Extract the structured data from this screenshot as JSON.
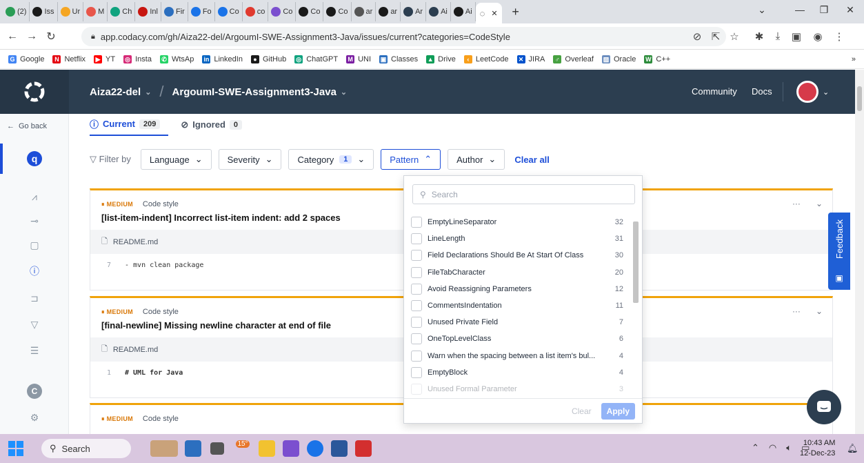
{
  "browser": {
    "tabs": [
      {
        "label": "(2)",
        "color": "#2a9d56"
      },
      {
        "label": "Iss",
        "color": "#1a1a1a"
      },
      {
        "label": "Ur",
        "color": "#f5a623"
      },
      {
        "label": "M",
        "color": "#e8564a"
      },
      {
        "label": "Ch",
        "color": "#10a37f"
      },
      {
        "label": "Inl",
        "color": "#c71610"
      },
      {
        "label": "Fir",
        "color": "#2c6fbf"
      },
      {
        "label": "Fo",
        "color": "#1a73e8"
      },
      {
        "label": "Co",
        "color": "#1a73e8"
      },
      {
        "label": "co",
        "color": "#e03a2f"
      },
      {
        "label": "Co",
        "color": "#7b4fcf"
      },
      {
        "label": "Co",
        "color": "#1a1a1a"
      },
      {
        "label": "Co",
        "color": "#1a1a1a"
      },
      {
        "label": "ar",
        "color": "#555555"
      },
      {
        "label": "ar",
        "color": "#1a1a1a"
      },
      {
        "label": "Ar",
        "color": "#2c3e50"
      },
      {
        "label": "Ai",
        "color": "#2c3e50"
      },
      {
        "label": "Ai",
        "color": "#1a1a1a"
      }
    ],
    "url": "app.codacy.com/gh/Aiza22-del/ArgoumI-SWE-Assignment3-Java/issues/current?categories=CodeStyle",
    "bookmarks": [
      {
        "label": "Google",
        "color": "#4285f4",
        "glyph": "G"
      },
      {
        "label": "Netflix",
        "color": "#e50914",
        "glyph": "N"
      },
      {
        "label": "YT",
        "color": "#ff0000",
        "glyph": "▶"
      },
      {
        "label": "Insta",
        "color": "#d62976",
        "glyph": "◎"
      },
      {
        "label": "WtsAp",
        "color": "#25d366",
        "glyph": "✆"
      },
      {
        "label": "LinkedIn",
        "color": "#0a66c2",
        "glyph": "in"
      },
      {
        "label": "GitHub",
        "color": "#1a1a1a",
        "glyph": "●"
      },
      {
        "label": "ChatGPT",
        "color": "#10a37f",
        "glyph": "◎"
      },
      {
        "label": "UNI",
        "color": "#7b1fa2",
        "glyph": "M"
      },
      {
        "label": "Classes",
        "color": "#2c6fbf",
        "glyph": "▣"
      },
      {
        "label": "Drive",
        "color": "#0f9d58",
        "glyph": "▲"
      },
      {
        "label": "LeetCode",
        "color": "#f89f1b",
        "glyph": "‹"
      },
      {
        "label": "JIRA",
        "color": "#0052cc",
        "glyph": "✕"
      },
      {
        "label": "Overleaf",
        "color": "#47a141",
        "glyph": "♂"
      },
      {
        "label": "Oracle",
        "color": "#6c8ebf",
        "glyph": "▨"
      },
      {
        "label": "C++",
        "color": "#2d8c3c",
        "glyph": "W"
      }
    ],
    "more_bookmarks": "»"
  },
  "header": {
    "org": "Aiza22-del",
    "repo": "ArgoumI-SWE-Assignment3-Java",
    "community": "Community",
    "docs": "Docs"
  },
  "sidebar": {
    "go_back": "Go back"
  },
  "issues_tabs": [
    {
      "label": "Current",
      "count": "209"
    },
    {
      "label": "Ignored",
      "count": "0"
    }
  ],
  "filters": {
    "filter_by": "Filter by",
    "language": "Language",
    "severity": "Severity",
    "category": "Category",
    "category_count": "1",
    "pattern": "Pattern",
    "author": "Author",
    "clear_all": "Clear all"
  },
  "issues": [
    {
      "severity": "MEDIUM",
      "category": "Code style",
      "title": "[list-item-indent] Incorrect list-item indent: add 2 spaces",
      "file": "README.md",
      "line": "7",
      "code": "- mvn clean package"
    },
    {
      "severity": "MEDIUM",
      "category": "Code style",
      "title": "[final-newline] Missing newline character at end of file",
      "file": "README.md",
      "line": "1",
      "code": "# UML for Java"
    },
    {
      "severity": "MEDIUM",
      "category": "Code style"
    }
  ],
  "pattern_dropdown": {
    "search_placeholder": "Search",
    "items": [
      {
        "name": "EmptyLineSeparator",
        "count": "32"
      },
      {
        "name": "LineLength",
        "count": "31"
      },
      {
        "name": "Field Declarations Should Be At Start Of Class",
        "count": "30"
      },
      {
        "name": "FileTabCharacter",
        "count": "20"
      },
      {
        "name": "Avoid Reassigning Parameters",
        "count": "12"
      },
      {
        "name": "CommentsIndentation",
        "count": "11"
      },
      {
        "name": "Unused Private Field",
        "count": "7"
      },
      {
        "name": "OneTopLevelClass",
        "count": "6"
      },
      {
        "name": "Warn when the spacing between a list item's bul...",
        "count": "4"
      },
      {
        "name": "EmptyBlock",
        "count": "4"
      },
      {
        "name": "Unused Formal Parameter",
        "count": "3"
      }
    ],
    "clear": "Clear",
    "apply": "Apply"
  },
  "feedback": "Feedback",
  "taskbar": {
    "search": "Search",
    "time": "10:43 AM",
    "date": "12-Dec-23",
    "weather": "15°"
  },
  "colors": {
    "accent": "#1d4ed8",
    "header_bg": "#2c3e50",
    "severity_medium": "#f0a30a"
  }
}
